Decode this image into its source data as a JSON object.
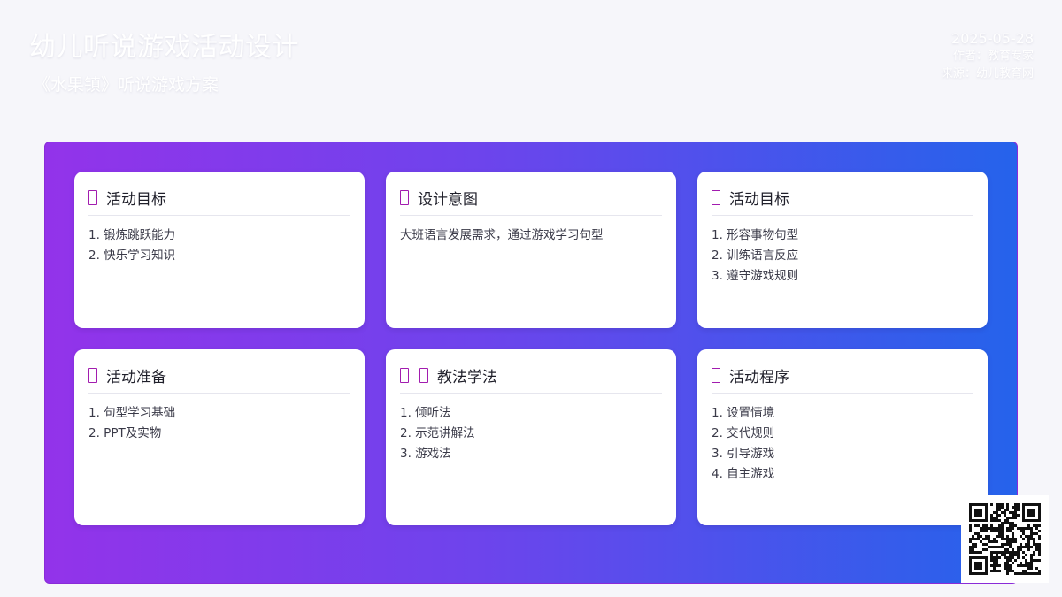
{
  "header": {
    "title": "幼儿听说游戏活动设计",
    "subtitle": "《水果镇》听说游戏方案"
  },
  "meta": {
    "date": "2025-05-28",
    "author": "作者：教育专家",
    "source": "来源：幼儿教育网"
  },
  "colors": {
    "panel_gradient_start": "#9333ea",
    "panel_gradient_end": "#2563eb",
    "icon_accent": "#a21caf"
  },
  "cards": [
    {
      "title": "活动目标",
      "icon": "target-icon",
      "lines": [
        "1. 锻炼跳跃能力",
        "2. 快乐学习知识"
      ]
    },
    {
      "title": "设计意图",
      "icon": "lightbulb-icon",
      "lines": [
        "大班语言发展需求，通过游戏学习句型"
      ]
    },
    {
      "title": "活动目标",
      "icon": "target-icon",
      "lines": [
        "1. 形容事物句型",
        "2. 训练语言反应",
        "3. 遵守游戏规则"
      ]
    },
    {
      "title": "活动准备",
      "icon": "toolbox-icon",
      "lines": [
        "1. 句型学习基础",
        "2. PPT及实物"
      ]
    },
    {
      "title": "教法学法",
      "icon": "teacher-icon",
      "lines": [
        "1. 倾听法",
        "2. 示范讲解法",
        "3. 游戏法"
      ]
    },
    {
      "title": "活动程序",
      "icon": "list-icon",
      "lines": [
        "1. 设置情境",
        "2. 交代规则",
        "3. 引导游戏",
        "4. 自主游戏"
      ]
    }
  ]
}
